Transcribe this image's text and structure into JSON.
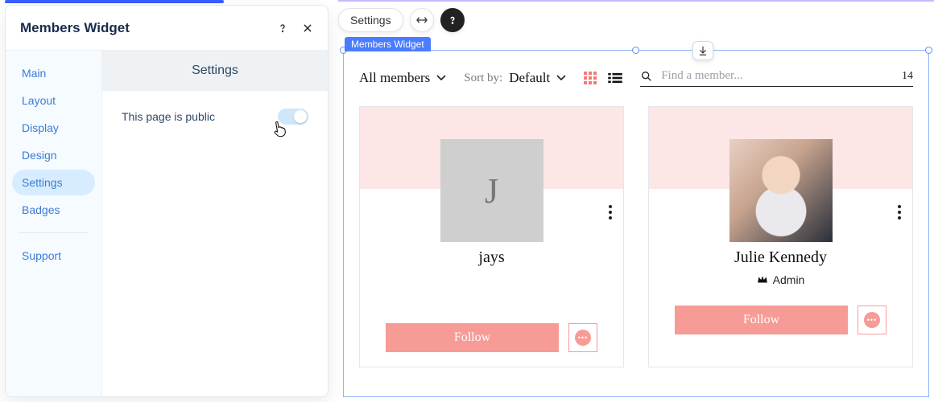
{
  "panel": {
    "title": "Members Widget",
    "sidebar": {
      "items": [
        {
          "label": "Main"
        },
        {
          "label": "Layout"
        },
        {
          "label": "Display"
        },
        {
          "label": "Design"
        },
        {
          "label": "Settings"
        },
        {
          "label": "Badges"
        }
      ],
      "support_label": "Support"
    },
    "content": {
      "header": "Settings",
      "public_toggle_label": "This page is public",
      "public_toggle_on": true
    }
  },
  "floating": {
    "settings_pill": "Settings"
  },
  "selection": {
    "tag": "Members Widget"
  },
  "widget": {
    "filter_label": "All members",
    "sort_label": "Sort by:",
    "sort_value": "Default",
    "search_placeholder": "Find a member...",
    "count": "14",
    "members": [
      {
        "name": "jays",
        "initial": "J",
        "has_photo": false,
        "role": "",
        "follow_label": "Follow"
      },
      {
        "name": "Julie Kennedy",
        "initial": "",
        "has_photo": true,
        "role": "Admin",
        "follow_label": "Follow"
      }
    ]
  },
  "colors": {
    "accent_pink": "#f79b96",
    "soft_pink": "#fde6e6",
    "blue": "#3b7bd6"
  }
}
